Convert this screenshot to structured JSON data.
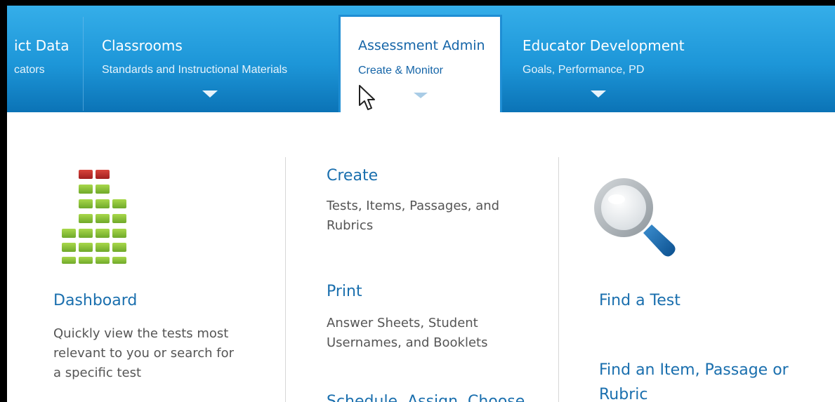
{
  "nav": {
    "items": [
      {
        "title": "ict Data",
        "subtitle": "cators"
      },
      {
        "title": "Classrooms",
        "subtitle": "Standards and Instructional Materials"
      },
      {
        "title": "Assessment Admin",
        "subtitle": "Create & Monitor"
      },
      {
        "title": "Educator Development",
        "subtitle": "Goals, Performance, PD"
      }
    ]
  },
  "menu": {
    "dashboard": {
      "title": "Dashboard",
      "desc_lines": [
        "Quickly view the tests most",
        "relevant to you or search for",
        "a specific test"
      ]
    },
    "create": {
      "title": "Create",
      "desc_lines": [
        "Tests, Items, Passages, and",
        "Rubrics"
      ]
    },
    "print": {
      "title": "Print",
      "desc_lines": [
        "Answer Sheets, Student",
        "Usernames, and Booklets"
      ]
    },
    "schedule": {
      "title": "Schedule, Assign, Choose"
    },
    "find_test": {
      "title": "Find a Test"
    },
    "find_item": {
      "title_lines": [
        "Find an Item, Passage or",
        "Rubric"
      ]
    }
  },
  "colors": {
    "nav_top": "#35aee9",
    "nav_bottom": "#0b73b6",
    "link": "#1a6fae",
    "bar_green": "#8cc63f",
    "bar_red": "#c1272d"
  },
  "icons": {
    "dashboard": "bar-chart-icon",
    "find": "magnifier-icon",
    "cursor": "mouse-pointer-icon"
  }
}
